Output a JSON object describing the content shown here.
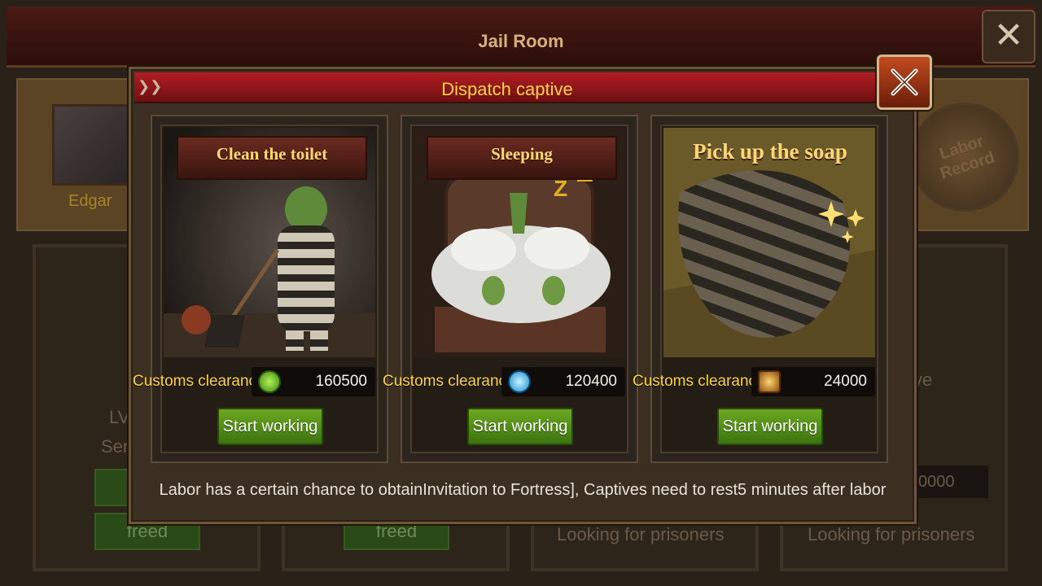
{
  "background": {
    "title": "Jail Room",
    "captive_name": "Edgar",
    "labor_record_label": "Labor Record",
    "slots": [
      {
        "level_label": "LV",
        "serve_label": "Serv",
        "button_label": "freed"
      },
      {
        "button_label": "freed"
      },
      {
        "button_label": "Looking for prisoners"
      },
      {
        "button_label": "Looking for prisoners",
        "field_value": "0000",
        "status_label": "ve"
      }
    ]
  },
  "dialog": {
    "title": "Dispatch captive",
    "footer": "Labor has a certain chance to obtainInvitation to Fortress], Captives need to rest5 minutes after labor"
  },
  "cards": [
    {
      "title": "Clean the toilet",
      "cost_label": "Customs clearance:",
      "cost_value": "160500",
      "cost_icon": "green-gem-icon",
      "button_label": "Start working"
    },
    {
      "title": "Sleeping",
      "cost_label": "Customs clearance:",
      "cost_value": "120400",
      "cost_icon": "blue-orb-icon",
      "button_label": "Start working"
    },
    {
      "title": "Pick up the soap",
      "cost_label": "Customs clearance:",
      "cost_value": "24000",
      "cost_icon": "gold-medal-icon",
      "button_label": "Start working"
    }
  ],
  "colors": {
    "title_gold": "#ffd24a",
    "button_green": "#5a9a1a",
    "titlebar_red": "#b21d22"
  }
}
